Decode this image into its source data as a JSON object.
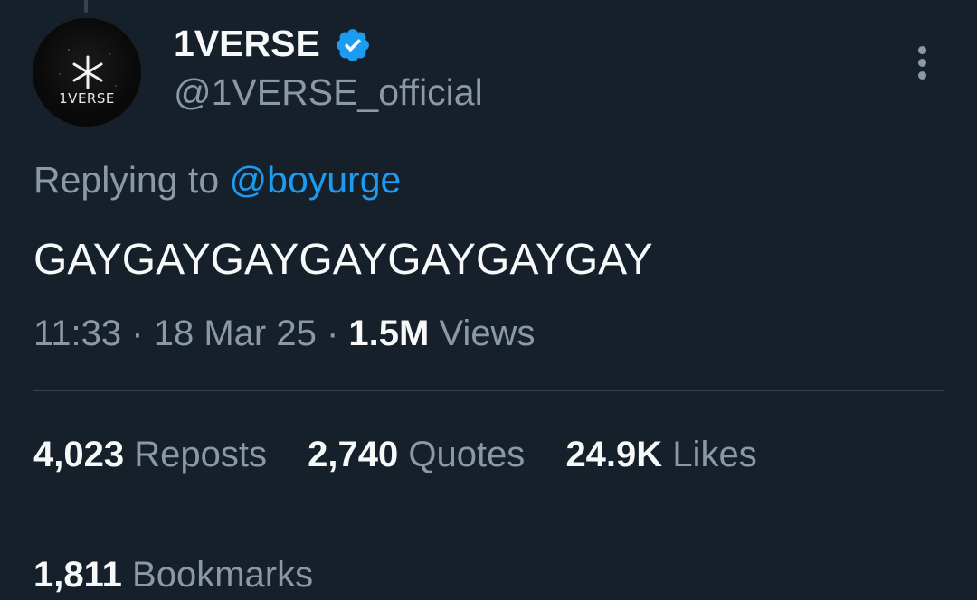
{
  "author": {
    "display_name": "1VERSE",
    "handle": "@1VERSE_official",
    "avatar_text": "1VERSE",
    "verified": true
  },
  "reply": {
    "prefix": "Replying to",
    "mention": "@boyurge"
  },
  "tweet": {
    "text": "GAYGAYGAYGAYGAYGAYGAY"
  },
  "meta": {
    "time": "11:33",
    "separator": "·",
    "date": "18 Mar 25",
    "views_count": "1.5M",
    "views_label": "Views"
  },
  "stats": {
    "reposts_count": "4,023",
    "reposts_label": "Reposts",
    "quotes_count": "2,740",
    "quotes_label": "Quotes",
    "likes_count": "24.9K",
    "likes_label": "Likes",
    "bookmarks_count": "1,811",
    "bookmarks_label": "Bookmarks"
  },
  "icons": {
    "verified": "verified-badge-icon",
    "more": "more-options-icon"
  },
  "colors": {
    "background": "#15202b",
    "text_primary": "#f7f9f9",
    "text_secondary": "#8b98a5",
    "accent": "#1d9bf0",
    "divider": "#38444d"
  }
}
